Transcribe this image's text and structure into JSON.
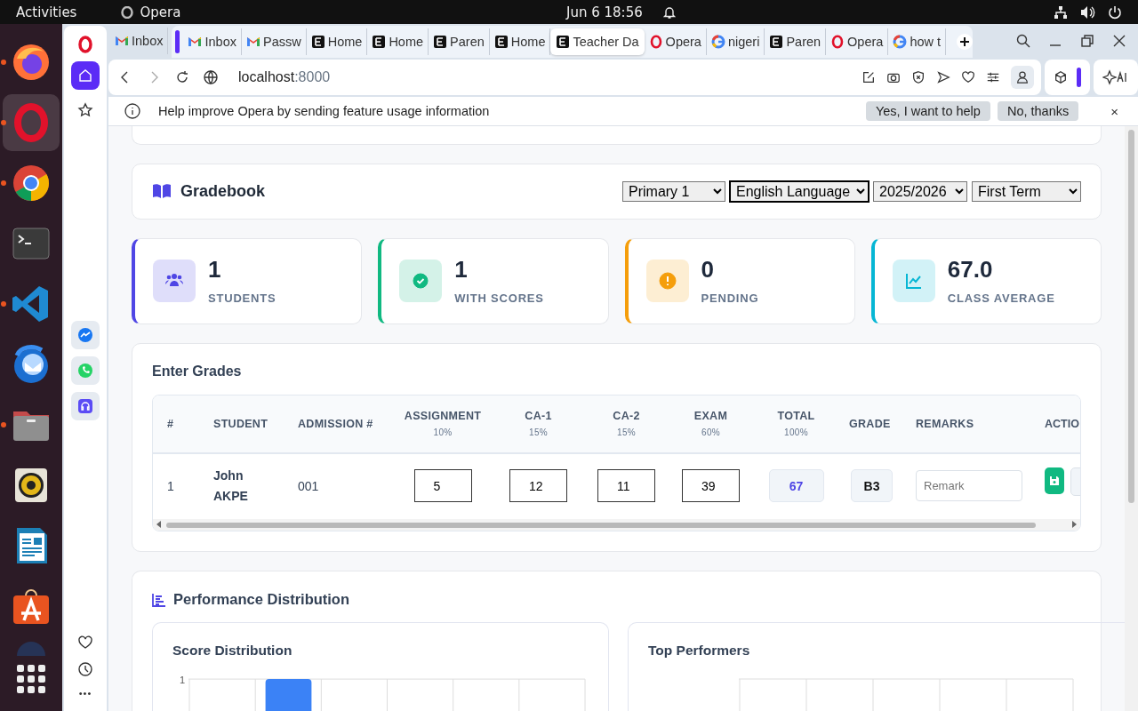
{
  "topbar": {
    "activities": "Activities",
    "app": "Opera",
    "clock": "Jun 6  18:56"
  },
  "dock": {
    "apps": [
      {
        "kind": "firefox",
        "running": true,
        "selected": false
      },
      {
        "kind": "opera",
        "running": true,
        "selected": true
      },
      {
        "kind": "chrome",
        "running": true,
        "selected": false
      },
      {
        "kind": "terminal",
        "running": false,
        "selected": false
      },
      {
        "kind": "vscode",
        "running": true,
        "selected": false
      },
      {
        "kind": "thunderbird",
        "running": false,
        "selected": false
      },
      {
        "kind": "files",
        "running": true,
        "selected": false
      },
      {
        "kind": "rhythmbox",
        "running": false,
        "selected": false
      },
      {
        "kind": "writer",
        "running": false,
        "selected": false
      },
      {
        "kind": "appstore",
        "running": false,
        "selected": false
      },
      {
        "kind": "partial"
      }
    ]
  },
  "sidebar": {
    "top": [
      {
        "kind": "home",
        "selected": true
      },
      {
        "kind": "bookmarks",
        "selected": false
      }
    ],
    "apps": [
      {
        "kind": "messenger"
      },
      {
        "kind": "whatsapp"
      },
      {
        "kind": "player"
      }
    ],
    "bottom": [
      {
        "kind": "heart"
      },
      {
        "kind": "history"
      }
    ],
    "more": "•••"
  },
  "loose_tabs": [
    {
      "kind": "gmail",
      "label": "Inbox",
      "selected": false
    }
  ],
  "tab_island": [
    {
      "kind": "gmail",
      "label": "Inbox",
      "selected": false
    },
    {
      "kind": "gmail",
      "label": "Passw",
      "selected": false
    },
    {
      "kind": "e",
      "label": "Home",
      "selected": false
    },
    {
      "kind": "e",
      "label": "Home",
      "selected": false
    },
    {
      "kind": "e",
      "label": "Paren",
      "selected": false
    },
    {
      "kind": "e",
      "label": "Home",
      "selected": false
    },
    {
      "kind": "e",
      "label": "Teacher Da",
      "selected": true
    },
    {
      "kind": "opera",
      "label": "Opera",
      "selected": false
    },
    {
      "kind": "google",
      "label": "nigeri",
      "selected": false
    },
    {
      "kind": "e",
      "label": "Paren",
      "selected": false
    },
    {
      "kind": "opera",
      "label": "Opera",
      "selected": false
    },
    {
      "kind": "google",
      "label": "how t",
      "selected": false
    }
  ],
  "address": {
    "host": "localhost",
    "port": ":8000"
  },
  "infobar": {
    "message": "Help improve Opera by sending feature usage information",
    "buttons": [
      "Yes, I want to help",
      "No, thanks"
    ],
    "close": "×"
  },
  "gradebook": {
    "title": "Gradebook",
    "filters": [
      {
        "value": "Primary 1",
        "focused": false
      },
      {
        "value": "English Language",
        "focused": true
      },
      {
        "value": "2025/2026",
        "focused": false
      },
      {
        "value": "First Term",
        "focused": false
      }
    ]
  },
  "stats": [
    {
      "kind": "users",
      "value": "1",
      "label": "STUDENTS",
      "color": "#4f46e5"
    },
    {
      "kind": "check",
      "value": "1",
      "label": "WITH SCORES",
      "color": "#10b981"
    },
    {
      "kind": "alert",
      "value": "0",
      "label": "PENDING",
      "color": "#f59e0b"
    },
    {
      "kind": "chart",
      "value": "67.0",
      "label": "CLASS AVERAGE",
      "color": "#06b6d4"
    }
  ],
  "grades": {
    "title": "Enter Grades",
    "columns": [
      {
        "label": "#"
      },
      {
        "label": "STUDENT"
      },
      {
        "label": "ADMISSION #"
      },
      {
        "label": "ASSIGNMENT",
        "weight": "10%"
      },
      {
        "label": "CA-1",
        "weight": "15%"
      },
      {
        "label": "CA-2",
        "weight": "15%"
      },
      {
        "label": "EXAM",
        "weight": "60%"
      },
      {
        "label": "TOTAL",
        "weight": "100%"
      },
      {
        "label": "GRADE"
      },
      {
        "label": "REMARKS"
      },
      {
        "label": "ACTIO"
      }
    ],
    "rows": [
      {
        "index": "1",
        "student": "John AKPE",
        "admission": "001",
        "scores": [
          "5",
          "12",
          "11",
          "39"
        ],
        "total": "67",
        "grade": "B3",
        "remark_placeholder": "Remark"
      }
    ]
  },
  "performance": {
    "title": "Performance Distribution",
    "panels": [
      {
        "title": "Score Distribution",
        "y_tick": "1"
      },
      {
        "title": "Top Performers"
      }
    ]
  }
}
